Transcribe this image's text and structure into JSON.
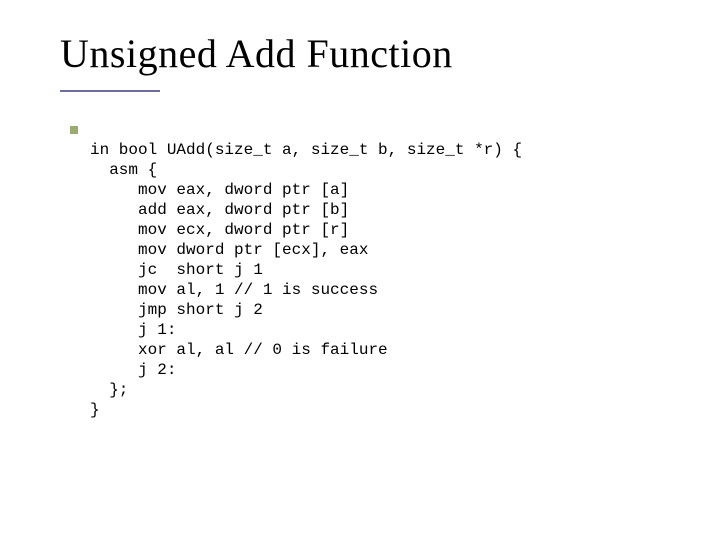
{
  "title": "Unsigned Add Function",
  "code_lines": [
    "in bool UAdd(size_t a, size_t b, size_t *r) {",
    "  asm {",
    "     mov eax, dword ptr [a]",
    "     add eax, dword ptr [b]",
    "     mov ecx, dword ptr [r]",
    "     mov dword ptr [ecx], eax",
    "     jc  short j 1",
    "     mov al, 1 // 1 is success",
    "     jmp short j 2",
    "     j 1:",
    "     xor al, al // 0 is failure",
    "     j 2:",
    "  };",
    "}"
  ]
}
